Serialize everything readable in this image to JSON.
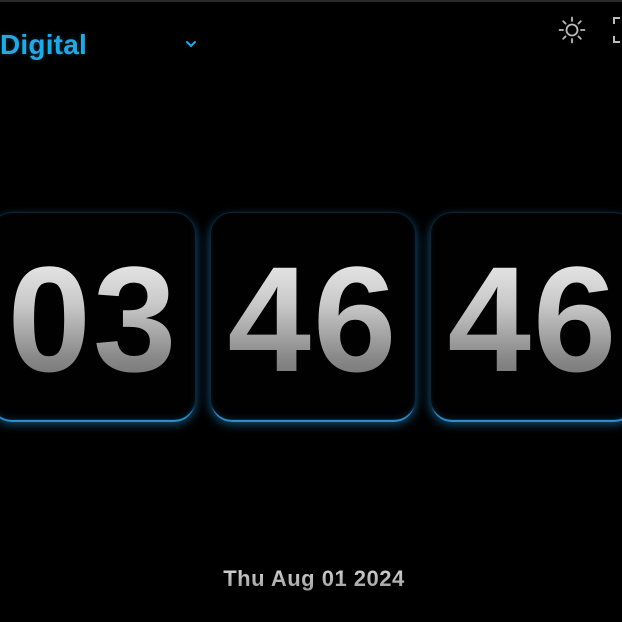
{
  "header": {
    "mode_label": "Digital",
    "mode_dropdown_icon": "chevron-down-icon",
    "theme_icon": "sun-icon",
    "fullscreen_icon": "fullscreen-icon"
  },
  "clock": {
    "hours": "03",
    "minutes": "46",
    "seconds": "46"
  },
  "date": "Thu Aug 01 2024",
  "colors": {
    "background": "#000000",
    "accent": "#25a8e0",
    "tile_glow": "#2a8fcf",
    "digit_top": "#f2f2f2",
    "digit_bottom": "#6a6a6a",
    "icon": "#bbbbbb"
  }
}
